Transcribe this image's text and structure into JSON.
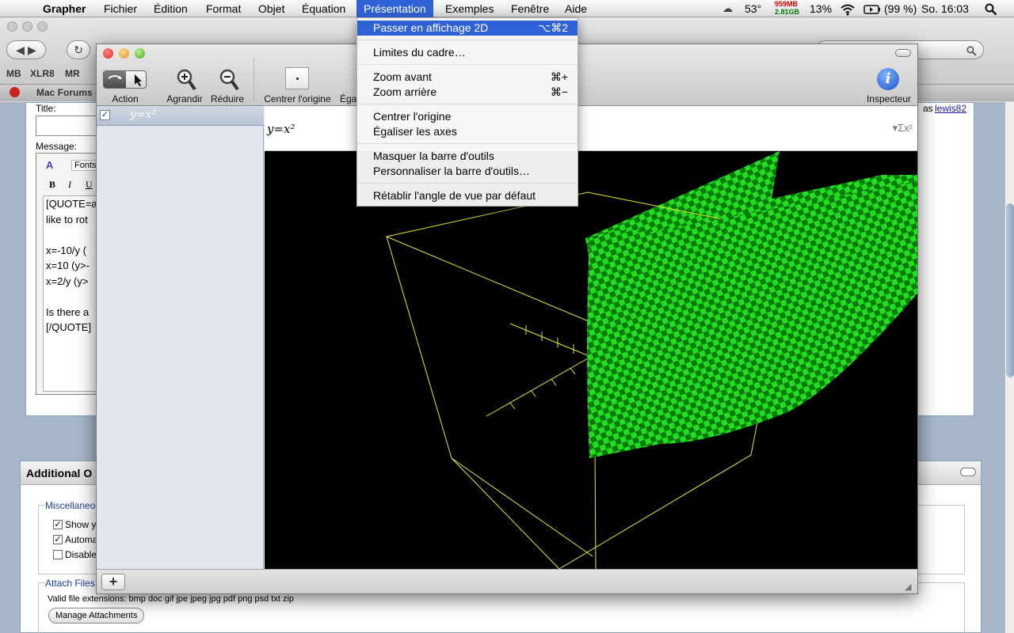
{
  "menubar": {
    "app": "Grapher",
    "items": [
      "Fichier",
      "Édition",
      "Format",
      "Objet",
      "Équation",
      "Présentation",
      "Exemples",
      "Fenêtre",
      "Aide"
    ],
    "status": {
      "temperature": "53°",
      "mem_used": "959MB",
      "mem_free": "2.81GB",
      "cpu": "13%",
      "battery": "(99 %)",
      "clock": "So. 16:03"
    }
  },
  "browser": {
    "bookmarks": [
      "MB",
      "XLR8",
      "MR"
    ],
    "tab_label": "Mac Forums -",
    "form": {
      "title_label": "Title:",
      "message_label": "Message:",
      "fonts_label": "Fonts",
      "format_buttons": [
        "B",
        "I",
        "U"
      ],
      "message_lines": [
        "[QUOTE=a",
        "like to rot",
        "",
        "x=-10/y (",
        "x=10 (y>-",
        "x=2/y (y>",
        "",
        "Is there a",
        "[/QUOTE]"
      ],
      "logged_as": "as",
      "username": "lewis82"
    },
    "additional": {
      "heading": "Additional O",
      "misc_legend": "Miscellaneou",
      "checkboxes": [
        {
          "label": "Show yo",
          "checked": true
        },
        {
          "label": "Automa",
          "checked": true
        },
        {
          "label": "Disable",
          "checked": false
        }
      ],
      "attach_legend": "Attach Files",
      "valid_ext": "Valid file extensions: bmp doc gif jpe jpeg jpg pdf png psd txt zip",
      "manage_button": "Manage Attachments"
    }
  },
  "grapher": {
    "toolbar": {
      "action": "Action",
      "zoom_in": "Agrandir",
      "zoom_out": "Réduire",
      "center": "Centrer l'origine",
      "equalize": "Égal",
      "inspector": "Inspecteur"
    },
    "equation": "y=x²",
    "colors": {
      "surface_light": "#22dd22",
      "surface_dark": "#0a7a0a",
      "box": "#e8e830",
      "background": "#000000"
    }
  },
  "dropdown": {
    "items": [
      {
        "label": "Passer en affichage 2D",
        "shortcut": "⌥⌘2",
        "highlighted": true
      },
      {
        "label": "Limites du cadre…",
        "shortcut": ""
      },
      {
        "label": "Zoom avant",
        "shortcut": "⌘+"
      },
      {
        "label": "Zoom arrière",
        "shortcut": "⌘−"
      },
      {
        "label": "Centrer l'origine",
        "shortcut": ""
      },
      {
        "label": "Égaliser les axes",
        "shortcut": ""
      },
      {
        "label": "Masquer la barre d'outils",
        "shortcut": ""
      },
      {
        "label": "Personnaliser la barre d'outils…",
        "shortcut": ""
      },
      {
        "label": "Rétablir l'angle de vue par défaut",
        "shortcut": ""
      }
    ]
  }
}
